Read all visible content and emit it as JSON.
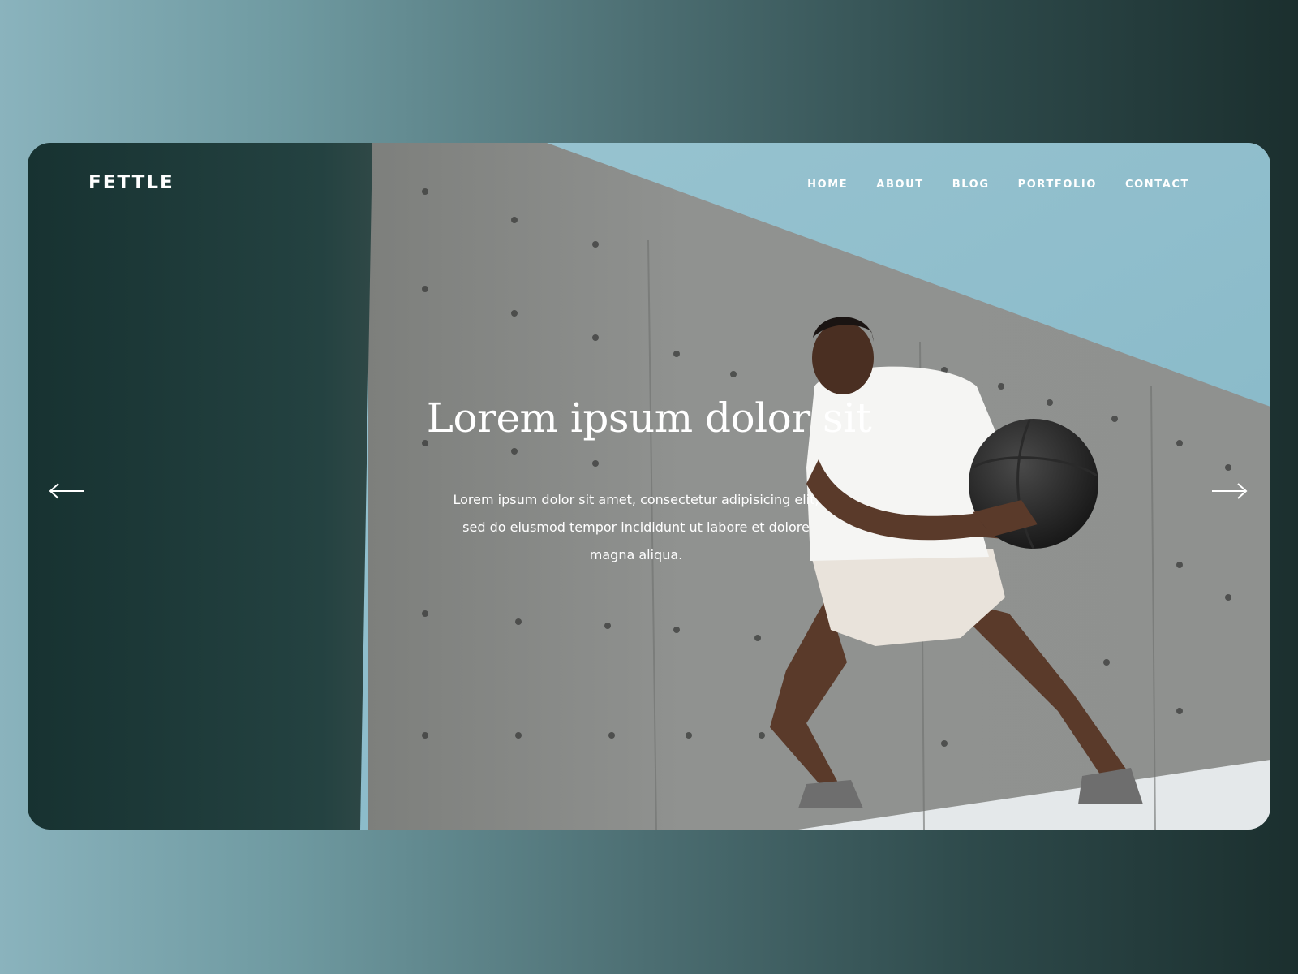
{
  "brand": {
    "logo_text": "FETTLE"
  },
  "nav": {
    "items": [
      {
        "label": "HOME"
      },
      {
        "label": "ABOUT"
      },
      {
        "label": "BLOG"
      },
      {
        "label": "PORTFOLIO"
      },
      {
        "label": "CONTACT"
      }
    ]
  },
  "hero": {
    "headline": "Lorem ipsum dolor sit",
    "lines": [
      "Lorem ipsum dolor sit amet, consectetur adipisicing elit,",
      "sed do eiusmod tempor incididunt ut labore et dolore",
      "magna aliqua."
    ],
    "prev_icon": "arrow-left-icon",
    "next_icon": "arrow-right-icon"
  },
  "colors": {
    "page_gradient_start": "#8ab3bd",
    "page_gradient_end": "#1b2f2e",
    "sky": "#8fbccb",
    "concrete": "#8e8f8d",
    "shadow_teal": "#1e3b3b",
    "text": "#ffffff"
  }
}
